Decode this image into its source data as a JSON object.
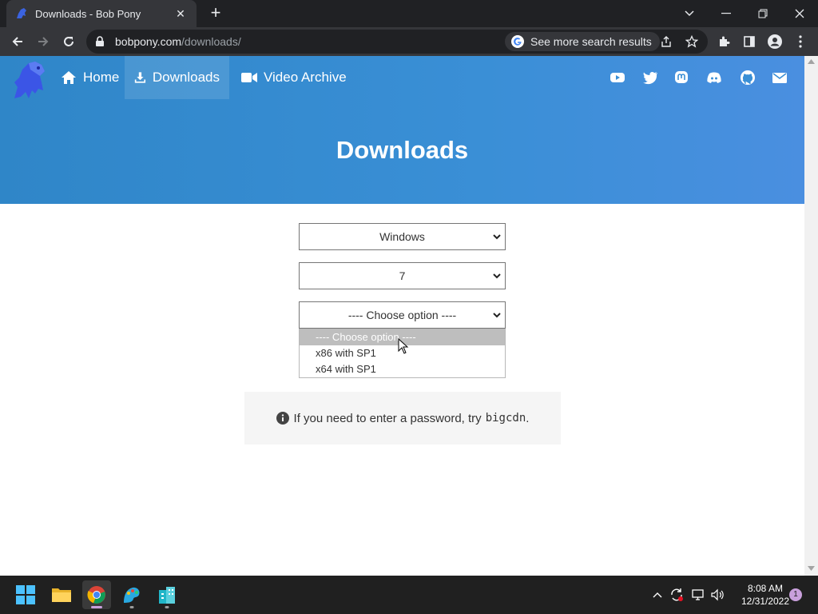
{
  "browser": {
    "tab_title": "Downloads - Bob Pony",
    "url_host": "bobpony.com",
    "url_path": "/downloads/",
    "search_chip": "See more search results"
  },
  "site": {
    "nav": {
      "home": "Home",
      "downloads": "Downloads",
      "video_archive": "Video Archive"
    },
    "social_icons": [
      "youtube-icon",
      "twitter-icon",
      "mastodon-icon",
      "discord-icon",
      "github-icon",
      "mail-icon"
    ],
    "page_title": "Downloads",
    "selects": {
      "os": "Windows",
      "version": "7",
      "edition": "---- Choose option ----"
    },
    "dropdown_options": [
      "---- Choose option ----",
      "x86 with SP1",
      "x64 with SP1"
    ],
    "note_text": "If you need to enter a password, try",
    "note_code": "bigcdn",
    "note_end": "."
  },
  "taskbar": {
    "time": "8:08 AM",
    "date": "12/31/2022",
    "notification_count": "1"
  },
  "colors": {
    "hero_gradient_start": "#2f86c8",
    "hero_gradient_end": "#4a8fe0",
    "browser_dark": "#202124"
  }
}
